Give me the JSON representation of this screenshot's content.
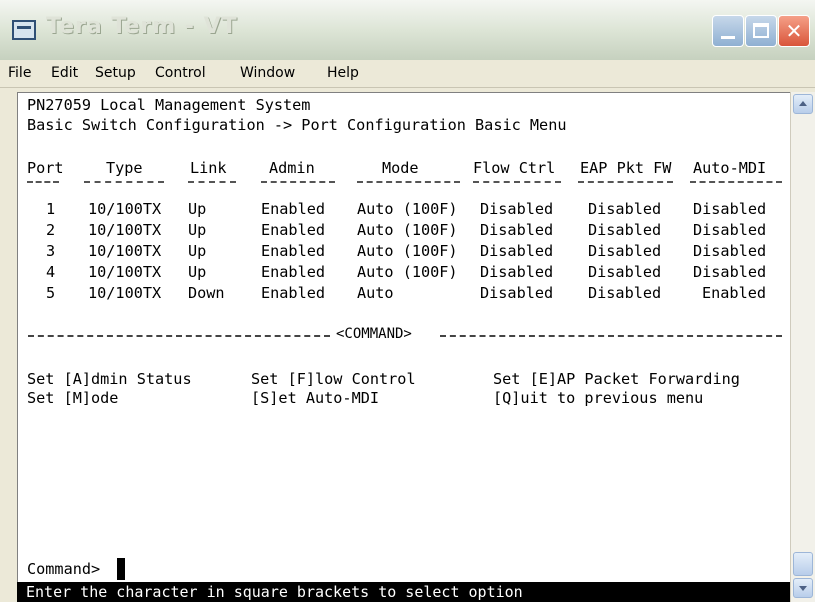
{
  "window": {
    "title": "Tera Term - VT"
  },
  "menu": [
    {
      "label": "File"
    },
    {
      "label": "Edit"
    },
    {
      "label": "Setup"
    },
    {
      "label": "Control"
    },
    {
      "label": "Window"
    },
    {
      "label": "Help"
    }
  ],
  "terminal": {
    "header_line1": "PN27059 Local Management System",
    "header_line2": "Basic Switch Configuration -> Port Configuration Basic Menu",
    "columns": [
      "Port",
      "Type",
      "Link",
      "Admin",
      "Mode",
      "Flow Ctrl",
      "EAP Pkt FW",
      "Auto-MDI"
    ],
    "rows": [
      [
        "1",
        "10/100TX",
        "Up",
        "Enabled",
        "Auto (100F)",
        "Disabled",
        "Disabled",
        "Disabled"
      ],
      [
        "2",
        "10/100TX",
        "Up",
        "Enabled",
        "Auto (100F)",
        "Disabled",
        "Disabled",
        "Disabled"
      ],
      [
        "3",
        "10/100TX",
        "Up",
        "Enabled",
        "Auto (100F)",
        "Disabled",
        "Disabled",
        "Disabled"
      ],
      [
        "4",
        "10/100TX",
        "Up",
        "Enabled",
        "Auto (100F)",
        "Disabled",
        "Disabled",
        "Disabled"
      ],
      [
        "5",
        "10/100TX",
        "Down",
        "Enabled",
        "Auto",
        "Disabled",
        "Disabled",
        "Enabled"
      ]
    ],
    "command_separator": "<COMMAND>",
    "commands": [
      [
        "Set [A]dmin Status",
        "Set [F]low Control",
        "Set [E]AP Packet Forwarding"
      ],
      [
        "Set [M]ode",
        "[S]et Auto-MDI",
        "[Q]uit to previous menu"
      ]
    ],
    "prompt": "Command>",
    "status_line": "Enter the character in square brackets to select option"
  },
  "colors": {
    "terminal_bg": "#ffffff",
    "terminal_fg": "#000000",
    "status_bg": "#000000",
    "status_fg": "#ffffff",
    "close_button": "#d9553a"
  },
  "icons": [
    "tera-term-app-icon",
    "minimize-icon",
    "maximize-icon",
    "close-icon",
    "scroll-up-icon",
    "scroll-down-icon"
  ]
}
